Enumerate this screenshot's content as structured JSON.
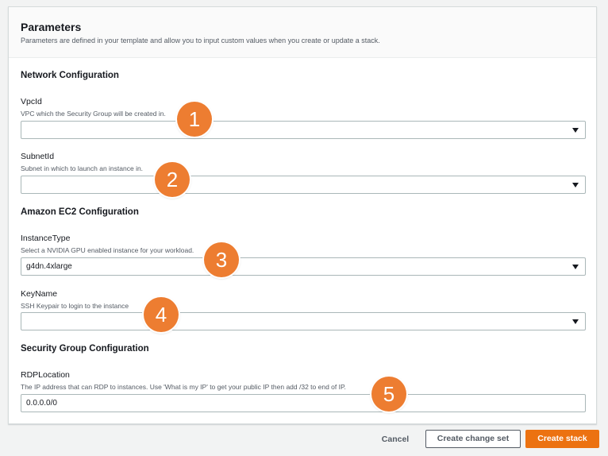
{
  "parameters": {
    "title": "Parameters",
    "description": "Parameters are defined in your template and allow you to input custom values when you create or update a stack."
  },
  "network": {
    "section_title": "Network Configuration",
    "vpc": {
      "label": "VpcId",
      "description": "VPC which the Security Group will be created in.",
      "value": ""
    },
    "subnet": {
      "label": "SubnetId",
      "description": "Subnet in which to launch an instance in.",
      "value": ""
    }
  },
  "ec2": {
    "section_title": "Amazon EC2 Configuration",
    "instance_type": {
      "label": "InstanceType",
      "description": "Select a NVIDIA GPU enabled instance for your workload.",
      "value": "g4dn.4xlarge"
    },
    "key_name": {
      "label": "KeyName",
      "description": "SSH Keypair to login to the instance",
      "value": ""
    }
  },
  "security": {
    "section_title": "Security Group Configuration",
    "rdp_location": {
      "label": "RDPLocation",
      "description": "The IP address that can RDP to instances. Use 'What is my IP' to get your public IP then add /32 to end of IP.",
      "value": "0.0.0.0/0"
    }
  },
  "callouts": [
    "1",
    "2",
    "3",
    "4",
    "5"
  ],
  "footer": {
    "cancel_label": "Cancel",
    "change_set_label": "Create change set",
    "create_label": "Create stack"
  },
  "colors": {
    "accent": "#ec7211",
    "callout": "#ed7d31"
  }
}
